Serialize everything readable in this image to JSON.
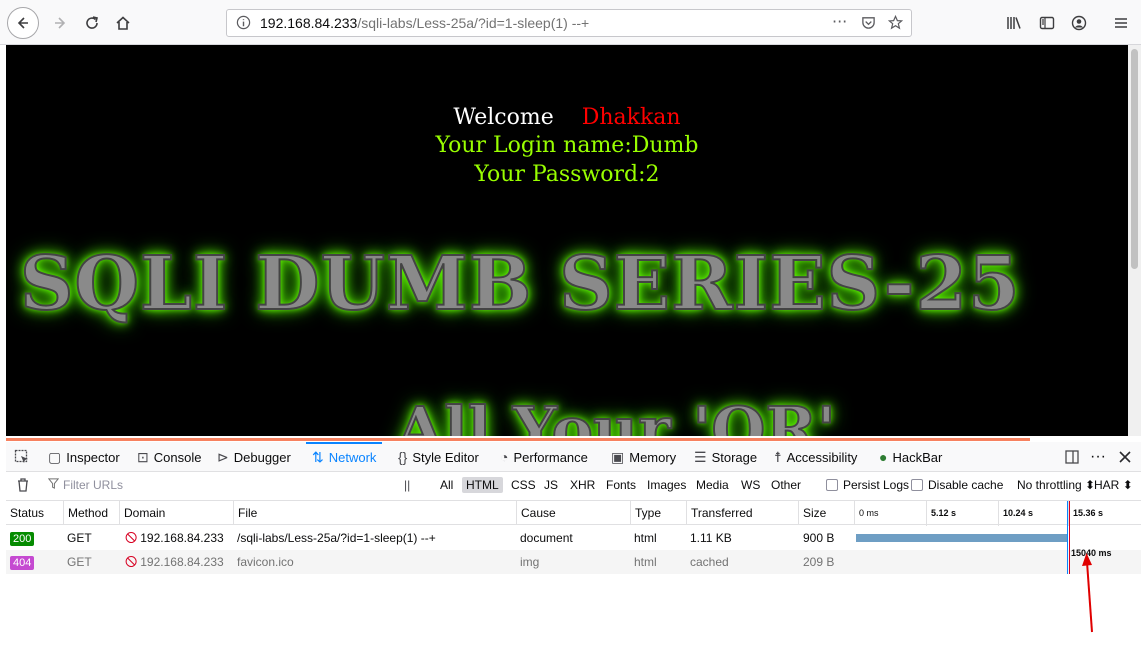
{
  "browser": {
    "url_host": "192.168.84.233",
    "url_path": "/sqli-labs/Less-25a/?id=1-sleep(1) --+",
    "icons": [
      "back-icon",
      "forward-icon",
      "reload-icon",
      "home-icon",
      "info-icon",
      "more-icon",
      "pocket-icon",
      "bookmark-star-icon",
      "library-icon",
      "sidebar-icon",
      "account-icon",
      "menu-icon"
    ]
  },
  "page": {
    "welcome_label": "Welcome",
    "welcome_name": "Dhakkan",
    "login_line": "Your Login name:Dumb",
    "password_line": "Your Password:2",
    "banner_title": "SQLI DUMB SERIES-25",
    "banner_subtitle": "All Your 'OR'",
    "colors": {
      "background": "#000000",
      "welcome": "#ffffff",
      "name": "#ff0000",
      "info": "#99ff00"
    }
  },
  "devtools": {
    "tabs": [
      {
        "label": "Inspector",
        "icon": "inspector-icon"
      },
      {
        "label": "Console",
        "icon": "console-icon"
      },
      {
        "label": "Debugger",
        "icon": "debugger-icon"
      },
      {
        "label": "Network",
        "icon": "network-icon",
        "active": true
      },
      {
        "label": "Style Editor",
        "icon": "style-editor-icon"
      },
      {
        "label": "Performance",
        "icon": "performance-icon"
      },
      {
        "label": "Memory",
        "icon": "memory-icon"
      },
      {
        "label": "Storage",
        "icon": "storage-icon"
      },
      {
        "label": "Accessibility",
        "icon": "accessibility-icon"
      },
      {
        "label": "HackBar",
        "icon": "hackbar-icon"
      }
    ],
    "filter_placeholder": "Filter URLs",
    "type_filters": [
      "All",
      "HTML",
      "CSS",
      "JS",
      "XHR",
      "Fonts",
      "Images",
      "Media",
      "WS",
      "Other"
    ],
    "selected_filter": "HTML",
    "persist_logs": "Persist Logs",
    "disable_cache": "Disable cache",
    "throttling": "No throttling",
    "har": "HAR",
    "columns": [
      "Status",
      "Method",
      "Domain",
      "File",
      "Cause",
      "Type",
      "Transferred",
      "Size"
    ],
    "timeline_ticks": [
      "0 ms",
      "5.12 s",
      "10.24 s",
      "15.36 s"
    ],
    "requests": [
      {
        "status": "200",
        "status_color": "#058b00",
        "method": "GET",
        "domain": "192.168.84.233",
        "file": "/sqli-labs/Less-25a/?id=1-sleep(1) --+",
        "cause": "document",
        "type": "html",
        "transferred": "1.11 KB",
        "size": "900 B",
        "timing": "15040 ms"
      },
      {
        "status": "404",
        "status_color": "#c54ad1",
        "method": "GET",
        "domain": "192.168.84.233",
        "file": "favicon.ico",
        "cause": "img",
        "type": "html",
        "transferred": "cached",
        "size": "209 B"
      }
    ],
    "accent_color": "#0a84ff"
  }
}
